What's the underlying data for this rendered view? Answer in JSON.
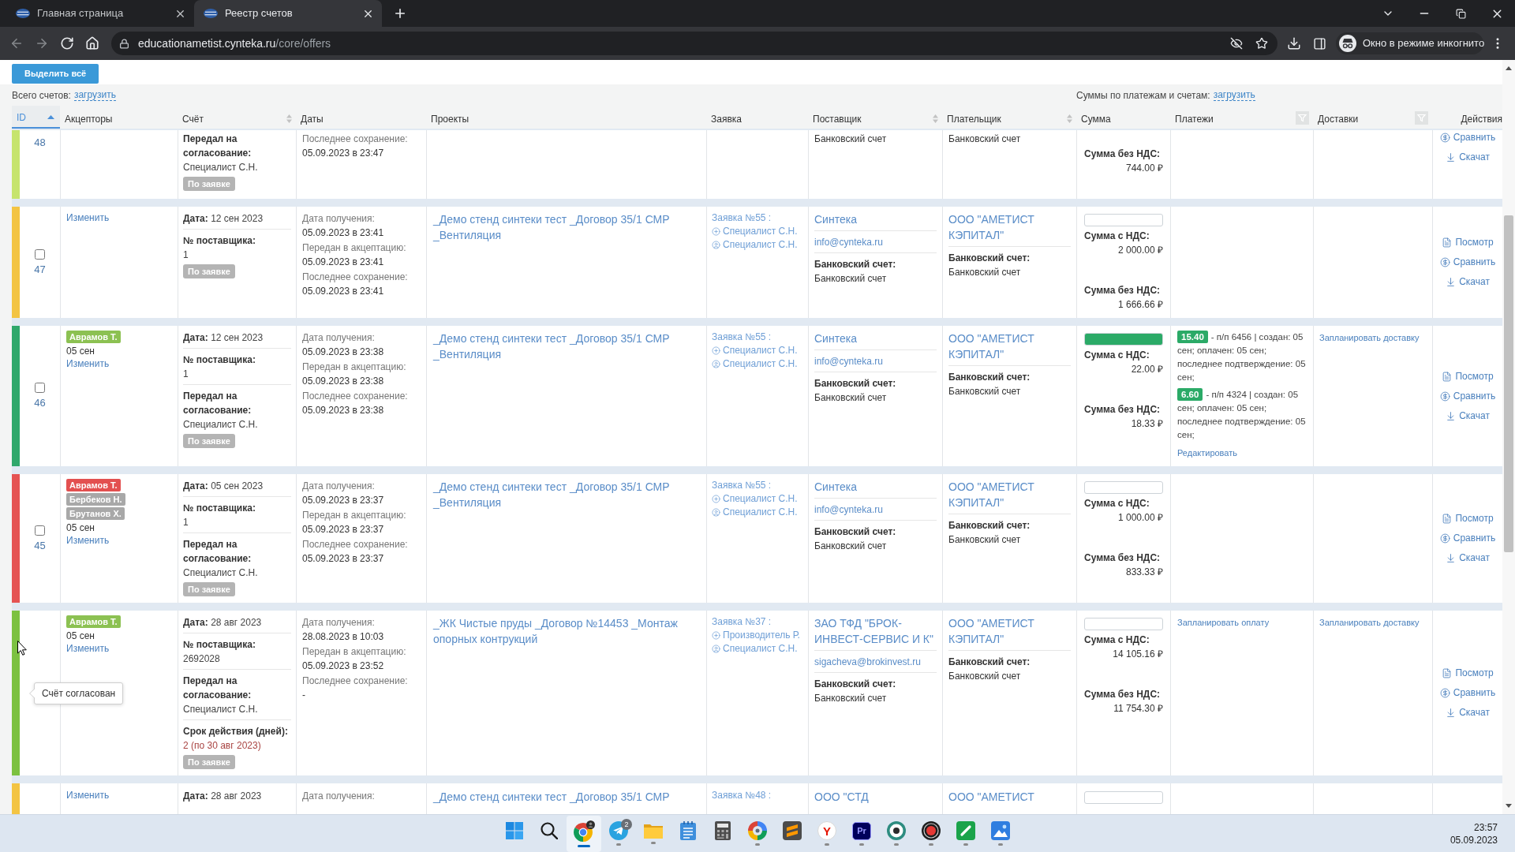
{
  "browser": {
    "tabs": [
      {
        "title": "Главная страница",
        "selected": false
      },
      {
        "title": "Реестр счетов",
        "selected": true
      }
    ],
    "nav_buttons": [
      {
        "kind": "back",
        "disabled": true
      },
      {
        "kind": "forward",
        "disabled": true
      },
      {
        "kind": "reload",
        "disabled": false
      },
      {
        "kind": "home",
        "disabled": false
      }
    ],
    "address": {
      "host": "educationametist.cynteka.ru",
      "path": "/core/offers"
    },
    "incognito_label": "Окно в режиме инкогнито"
  },
  "toolbar": {
    "select_all_button": "Выделить всё"
  },
  "summary": {
    "total_label": "Всего счетов:",
    "total_link": "загрузить",
    "sums_label": "Суммы по платежам и счетам:",
    "sums_link": "загрузить"
  },
  "table": {
    "columns": [
      {
        "label": "ID",
        "kind": "sorted"
      },
      {
        "label": "Акцепторы",
        "kind": "plain"
      },
      {
        "label": "Счёт",
        "kind": "sortable"
      },
      {
        "label": "Даты",
        "kind": "plain"
      },
      {
        "label": "Проекты",
        "kind": "plain"
      },
      {
        "label": "Заявка",
        "kind": "plain"
      },
      {
        "label": "Поставщик",
        "kind": "sortable"
      },
      {
        "label": "Плательщик",
        "kind": "sortable"
      },
      {
        "label": "Сумма",
        "kind": "plain"
      },
      {
        "label": "Платежи",
        "kind": "filter"
      },
      {
        "label": "Доставки",
        "kind": "filter"
      },
      {
        "label": "Действия",
        "kind": "plain"
      }
    ],
    "rows": [
      {
        "kind": "cut-top",
        "id": "48",
        "color": "#c6e46d",
        "invoice": {
          "fields": [
            {
              "kind": "block",
              "label": "Передал на согласование:",
              "value": "Специалист С.Н."
            }
          ],
          "tag": "По заявке"
        },
        "dates": [
          {
            "label": "Последнее сохранение:",
            "value": "05.09.2023 в 23:47"
          }
        ],
        "supplier": {
          "bank_value": "Банковский счет"
        },
        "payer": {
          "bank_value": "Банковский счет"
        },
        "sum": {
          "without_vat_label": "Сумма без НДС:",
          "without_vat": "744.00 ₽"
        },
        "actions": [
          {
            "kind": "compare",
            "label": "Сравнить"
          },
          {
            "kind": "download",
            "label": "Скачат"
          }
        ]
      },
      {
        "kind": "full",
        "id": "47",
        "checked": false,
        "color": "#f3c443",
        "acceptors": {
          "edit_link": "Изменить"
        },
        "invoice": {
          "fields": [
            {
              "kind": "inline",
              "label": "Дата:",
              "value": "12 сен 2023"
            },
            {
              "kind": "block",
              "label": "№ поставщика:",
              "value": "1"
            }
          ],
          "tag": "По заявке"
        },
        "dates": [
          {
            "label": "Дата получения:",
            "value": "05.09.2023 в 23:41"
          },
          {
            "label": "Передан в акцептацию:",
            "value": "05.09.2023 в 23:41"
          },
          {
            "label": "Последнее сохранение:",
            "value": "05.09.2023 в 23:41"
          }
        ],
        "project": "_Демо стенд синтеки тест _Договор 35/1 СМР _Вентиляция",
        "request": {
          "title": "Заявка №55 :",
          "people": [
            {
              "kind": "author",
              "name": "Специалист С.Н."
            },
            {
              "kind": "responsible",
              "name": "Специалист С.Н."
            }
          ]
        },
        "supplier": {
          "name": "Синтека",
          "email": "info@cynteka.ru",
          "bank_label": "Банковский счет:",
          "bank_value": "Банковский счет"
        },
        "payer": {
          "name": "ООО \"АМЕТИСТ КЭПИТАЛ\"",
          "bank_label": "Банковский счет:",
          "bank_value": "Банковский счет"
        },
        "sum": {
          "level": 0,
          "with_vat_label": "Сумма с НДС:",
          "with_vat": "2 000.00 ₽",
          "without_vat_label": "Сумма без НДС:",
          "without_vat": "1 666.66 ₽"
        },
        "actions": [
          {
            "kind": "view",
            "label": "Посмотр"
          },
          {
            "kind": "compare",
            "label": "Сравнить"
          },
          {
            "kind": "download",
            "label": "Скачат"
          }
        ]
      },
      {
        "kind": "full",
        "id": "46",
        "checked": false,
        "color": "#2fa86b",
        "acceptors": {
          "badges": [
            {
              "name": "Аврамов Т.",
              "color": "#8cc152"
            }
          ],
          "date": "05 сен",
          "edit_link": "Изменить"
        },
        "invoice": {
          "fields": [
            {
              "kind": "inline",
              "label": "Дата:",
              "value": "12 сен 2023"
            },
            {
              "kind": "block",
              "label": "№ поставщика:",
              "value": "1"
            },
            {
              "kind": "block",
              "label": "Передал на согласование:",
              "value": "Специалист С.Н."
            }
          ],
          "tag": "По заявке"
        },
        "dates": [
          {
            "label": "Дата получения:",
            "value": "05.09.2023 в 23:38"
          },
          {
            "label": "Передан в акцептацию:",
            "value": "05.09.2023 в 23:38"
          },
          {
            "label": "Последнее сохранение:",
            "value": "05.09.2023 в 23:38"
          }
        ],
        "project": "_Демо стенд синтеки тест _Договор 35/1 СМР _Вентиляция",
        "request": {
          "title": "Заявка №55 :",
          "people": [
            {
              "kind": "author",
              "name": "Специалист С.Н."
            },
            {
              "kind": "responsible",
              "name": "Специалист С.Н."
            }
          ]
        },
        "supplier": {
          "name": "Синтека",
          "email": "info@cynteka.ru",
          "bank_label": "Банковский счет:",
          "bank_value": "Банковский счет"
        },
        "payer": {
          "name": "ООО \"АМЕТИСТ КЭПИТАЛ\"",
          "bank_label": "Банковский счет:",
          "bank_value": "Банковский счет"
        },
        "sum": {
          "level": 1,
          "with_vat_label": "Сумма с НДС:",
          "with_vat": "22.00 ₽",
          "without_vat_label": "Сумма без НДС:",
          "without_vat": "18.33 ₽"
        },
        "payments": {
          "items": [
            {
              "amount": "15.40",
              "details": "- п/п 6456 | создан: 05 сен; оплачен: 05 сен; последнее подтверждение: 05 сен;"
            },
            {
              "amount": "6.60",
              "details": "- п/п 4324 | создан: 05 сен; оплачен: 05 сен; последнее подтверждение: 05 сен;"
            }
          ],
          "link": "Редактировать"
        },
        "deliveries": {
          "link": "Запланировать доставку"
        },
        "actions": [
          {
            "kind": "view",
            "label": "Посмотр"
          },
          {
            "kind": "compare",
            "label": "Сравнить"
          },
          {
            "kind": "download",
            "label": "Скачат"
          }
        ]
      },
      {
        "kind": "full",
        "id": "45",
        "checked": false,
        "color": "#e55353",
        "acceptors": {
          "badges": [
            {
              "name": "Аврамов Т.",
              "color": "#e35050"
            },
            {
              "name": "Бербеков Н.",
              "color": "#a8a8a8"
            },
            {
              "name": "Брутанов Х.",
              "color": "#a8a8a8"
            }
          ],
          "date": "05 сен",
          "edit_link": "Изменить"
        },
        "invoice": {
          "fields": [
            {
              "kind": "inline",
              "label": "Дата:",
              "value": "05 сен 2023"
            },
            {
              "kind": "block",
              "label": "№ поставщика:",
              "value": "1"
            },
            {
              "kind": "block",
              "label": "Передал на согласование:",
              "value": "Специалист С.Н."
            }
          ],
          "tag": "По заявке"
        },
        "dates": [
          {
            "label": "Дата получения:",
            "value": "05.09.2023 в 23:37"
          },
          {
            "label": "Передан в акцептацию:",
            "value": "05.09.2023 в 23:37"
          },
          {
            "label": "Последнее сохранение:",
            "value": "05.09.2023 в 23:37"
          }
        ],
        "project": "_Демо стенд синтеки тест _Договор 35/1 СМР _Вентиляция",
        "request": {
          "title": "Заявка №55 :",
          "people": [
            {
              "kind": "author",
              "name": "Специалист С.Н."
            },
            {
              "kind": "responsible",
              "name": "Специалист С.Н."
            }
          ]
        },
        "supplier": {
          "name": "Синтека",
          "email": "info@cynteka.ru",
          "bank_label": "Банковский счет:",
          "bank_value": "Банковский счет"
        },
        "payer": {
          "name": "ООО \"АМЕТИСТ КЭПИТАЛ\"",
          "bank_label": "Банковский счет:",
          "bank_value": "Банковский счет"
        },
        "sum": {
          "level": 0,
          "with_vat_label": "Сумма с НДС:",
          "with_vat": "1 000.00 ₽",
          "without_vat_label": "Сумма без НДС:",
          "without_vat": "833.33 ₽"
        },
        "actions": [
          {
            "kind": "view",
            "label": "Посмотр"
          },
          {
            "kind": "compare",
            "label": "Сравнить"
          },
          {
            "kind": "download",
            "label": "Скачат"
          }
        ]
      },
      {
        "kind": "full",
        "color": "#7cc141",
        "tooltip": "Счёт согласован",
        "acceptors": {
          "badges": [
            {
              "name": "Аврамов Т.",
              "color": "#8cc152"
            }
          ],
          "date": "05 сен",
          "edit_link": "Изменить"
        },
        "invoice": {
          "fields": [
            {
              "kind": "inline",
              "label": "Дата:",
              "value": "28 авг 2023"
            },
            {
              "kind": "block",
              "label": "№ поставщика:",
              "value": "2692028"
            },
            {
              "kind": "block",
              "label": "Передал на согласование:",
              "value": "Специалист С.Н."
            },
            {
              "kind": "alert",
              "label": "Срок действия (дней):",
              "value": "2 (по 30 авг 2023)"
            }
          ],
          "tag": "По заявке"
        },
        "dates": [
          {
            "label": "Дата получения:",
            "value": "28.08.2023 в 10:03"
          },
          {
            "label": "Передан в акцептацию:",
            "value": "05.09.2023 в 23:52"
          },
          {
            "label": "Последнее сохранение:",
            "value": "-"
          }
        ],
        "project": "_ЖК Чистые пруды _Договор №14453 _Монтаж опорных контрукций",
        "request": {
          "title": "Заявка №37 :",
          "people": [
            {
              "kind": "author",
              "name": "Производитель Р."
            },
            {
              "kind": "responsible",
              "name": "Специалист С.Н."
            }
          ]
        },
        "supplier": {
          "name": "ЗАО ТФД \"БРОК-ИНВЕСТ-СЕРВИС И К\"",
          "email": "sigacheva@brokinvest.ru",
          "bank_label": "Банковский счет:",
          "bank_value": "Банковский счет"
        },
        "payer": {
          "name": "ООО \"АМЕТИСТ КЭПИТАЛ\"",
          "bank_label": "Банковский счет:",
          "bank_value": "Банковский счет"
        },
        "sum": {
          "level": 0,
          "with_vat_label": "Сумма с НДС:",
          "with_vat": "14 105.16 ₽",
          "without_vat_label": "Сумма без НДС:",
          "without_vat": "11 754.30 ₽"
        },
        "payments": {
          "link": "Запланировать оплату"
        },
        "deliveries": {
          "link": "Запланировать доставку"
        },
        "actions": [
          {
            "kind": "view",
            "label": "Посмотр"
          },
          {
            "kind": "compare",
            "label": "Сравнить"
          },
          {
            "kind": "download",
            "label": "Скачат"
          }
        ]
      },
      {
        "kind": "cut-bottom",
        "color": "#f3c443",
        "acceptors": {
          "edit_link": "Изменить"
        },
        "invoice": {
          "fields": [
            {
              "kind": "inline",
              "label": "Дата:",
              "value": "28 авг 2023"
            }
          ]
        },
        "dates": [
          {
            "label": "Дата получения:"
          }
        ],
        "project": "_Демо стенд синтеки тест _Договор 35/1 СМР",
        "request": {
          "title": "Заявка №48 :"
        },
        "supplier": {
          "name": "ООО \"СТД"
        },
        "payer": {
          "name": "ООО \"АМЕТИСТ"
        },
        "sum": {
          "level": 0
        }
      }
    ]
  },
  "taskbar": {
    "apps": [
      {
        "kind": "start",
        "running": false,
        "selected": false
      },
      {
        "kind": "search",
        "running": false,
        "selected": false
      },
      {
        "kind": "chrome",
        "running": true,
        "selected": true
      },
      {
        "kind": "telegram",
        "running": true,
        "selected": false,
        "badge": "2"
      },
      {
        "kind": "explorer",
        "running": true,
        "selected": false
      },
      {
        "kind": "notepad",
        "running": false,
        "selected": false
      },
      {
        "kind": "calculator",
        "running": false,
        "selected": false
      },
      {
        "kind": "pinwheel",
        "running": true,
        "selected": false
      },
      {
        "kind": "sublime",
        "running": false,
        "selected": false
      },
      {
        "kind": "yandex",
        "glyph": "Y",
        "running": true,
        "selected": false
      },
      {
        "kind": "premiere",
        "glyph": "Pr",
        "running": true,
        "selected": false
      },
      {
        "kind": "ring",
        "running": true,
        "selected": false
      },
      {
        "kind": "recorder",
        "running": true,
        "selected": false
      },
      {
        "kind": "green-tile",
        "running": true,
        "selected": false
      },
      {
        "kind": "picture",
        "running": true,
        "selected": false
      }
    ],
    "time": "23:57",
    "date": "05.09.2023"
  }
}
